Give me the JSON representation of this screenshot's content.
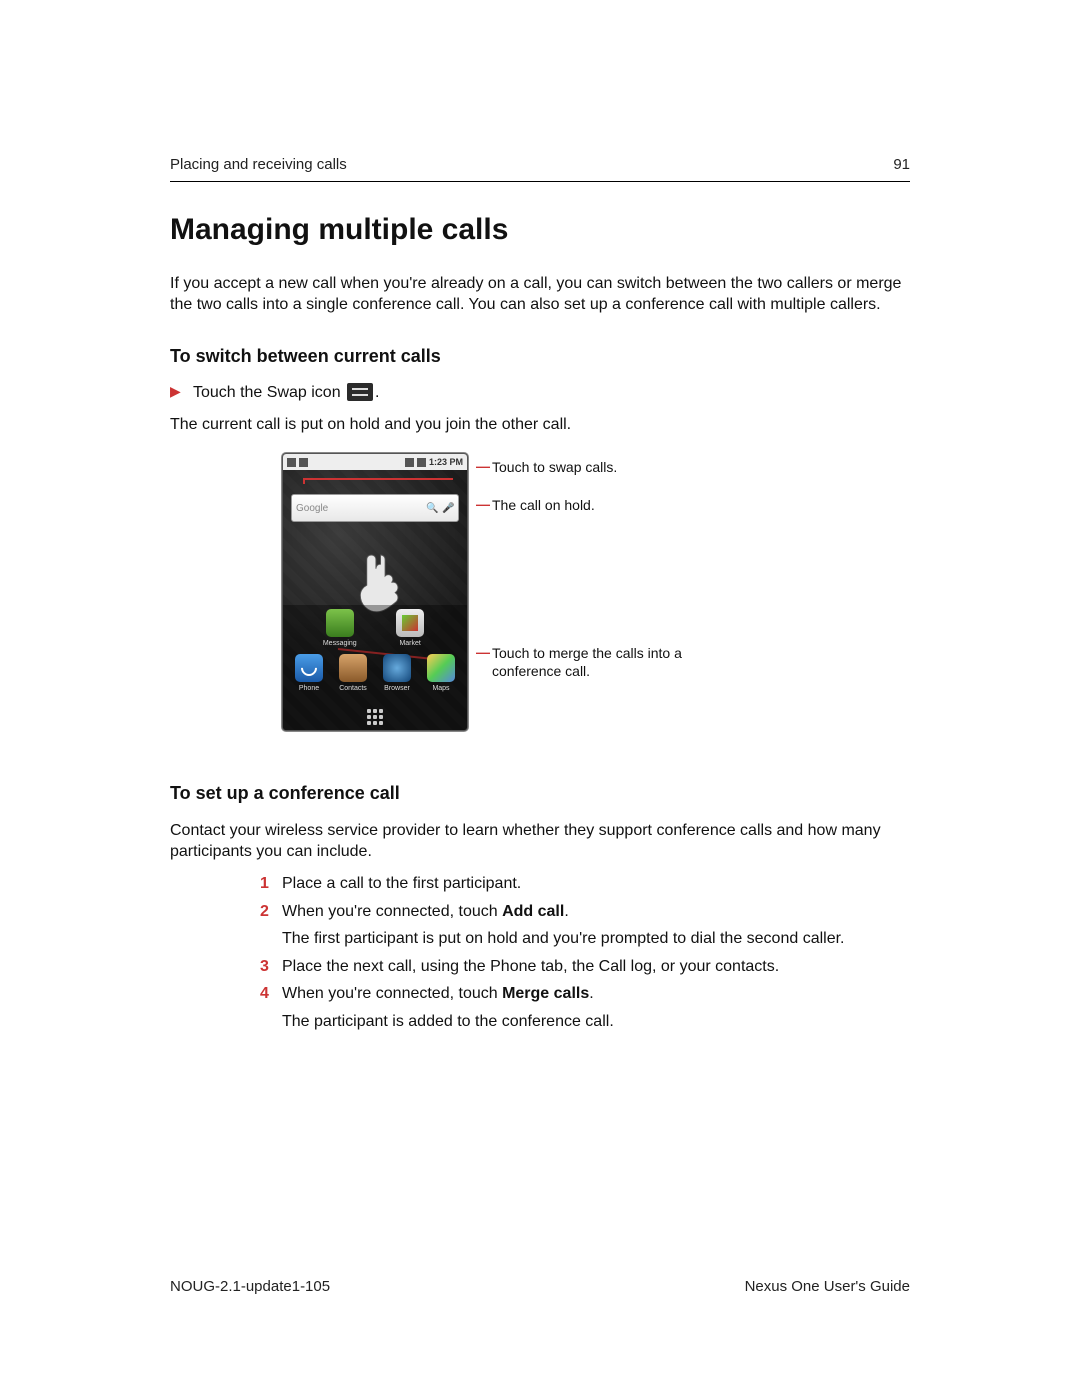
{
  "header": {
    "section": "Placing and receiving calls",
    "page_number": "91"
  },
  "title": "Managing multiple calls",
  "intro": "If you accept a new call when you're already on a call, you can switch between the two callers or merge the two calls into a single conference call. You can also set up a conference call with multiple callers.",
  "section_switch": {
    "heading": "To switch between current calls",
    "step_prefix": "Touch the Swap icon",
    "step_suffix": ".",
    "result": "The current call is put on hold and you join the other call."
  },
  "figure": {
    "statusbar_time": "1:23 PM",
    "search_placeholder": "Google",
    "apps_row1": [
      {
        "label": "Messaging"
      },
      {
        "label": "Market"
      }
    ],
    "apps_row2": [
      {
        "label": "Phone"
      },
      {
        "label": "Contacts"
      },
      {
        "label": "Browser"
      },
      {
        "label": "Maps"
      }
    ],
    "callouts": {
      "swap": "Touch to swap calls.",
      "hold": "The call on hold.",
      "merge": "Touch to merge the calls into a conference call."
    }
  },
  "section_conf": {
    "heading": "To set up a conference call",
    "intro": "Contact your wireless service provider to learn whether they support conference calls and how many participants you can include.",
    "steps": [
      {
        "n": "1",
        "text_a": "Place a call to the first participant."
      },
      {
        "n": "2",
        "text_a": "When you're connected, touch ",
        "bold": "Add call",
        "text_b": ".",
        "after": "The first participant is put on hold and you're prompted to dial the second caller."
      },
      {
        "n": "3",
        "text_a": "Place the next call, using the Phone tab, the Call log, or your contacts."
      },
      {
        "n": "4",
        "text_a": "When you're connected, touch ",
        "bold": "Merge calls",
        "text_b": ".",
        "after": "The participant is added to the conference call."
      }
    ]
  },
  "footer": {
    "left": "NOUG-2.1-update1-105",
    "right": "Nexus One User's Guide"
  }
}
